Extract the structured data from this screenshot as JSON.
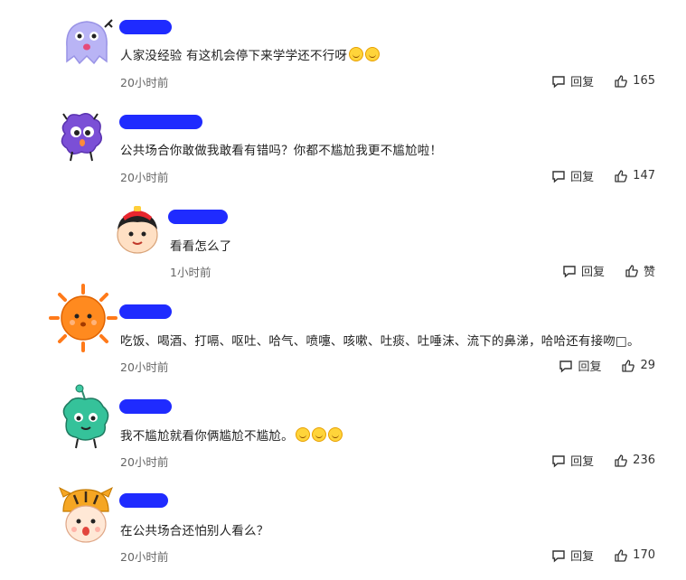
{
  "comments": [
    {
      "avatar": "ghost-avatar",
      "text": "人家没经验 有这机会停下来学学还不行呀",
      "emojis": [
        "smile-emoji",
        "grin-emoji"
      ],
      "time": "20小时前",
      "reply": "回复",
      "likes": "165"
    },
    {
      "avatar": "purple-monster-avatar",
      "text": "公共场合你敢做我敢看有错吗？你都不尴尬我更不尴尬啦！",
      "emojis": [],
      "time": "20小时前",
      "reply": "回复",
      "likes": "147"
    },
    {
      "avatar": "boy-avatar",
      "text": "看看怎么了",
      "emojis": [],
      "time": "1小时前",
      "reply": "回复",
      "likes": "赞"
    },
    {
      "avatar": "sun-avatar",
      "text": "吃饭、喝酒、打嗝、呕吐、哈气、喷嚏、咳嗽、吐痰、吐唾沫、流下的鼻涕，哈哈还有接吻□。",
      "emojis": [],
      "time": "20小时前",
      "reply": "回复",
      "likes": "29"
    },
    {
      "avatar": "green-monster-avatar",
      "text": "我不尴尬就看你俩尴尬不尴尬。",
      "emojis": [
        "laugh-cry-emoji",
        "laugh-cry-emoji",
        "laugh-cry-emoji"
      ],
      "time": "20小时前",
      "reply": "回复",
      "likes": "236"
    },
    {
      "avatar": "tiger-hat-avatar",
      "text": "在公共场合还怕别人看么？",
      "emojis": [],
      "time": "20小时前",
      "reply": "回复",
      "likes": "170"
    }
  ],
  "colors": {
    "name_redaction": "#1f2bff",
    "text": "#222222",
    "time": "#666666"
  }
}
